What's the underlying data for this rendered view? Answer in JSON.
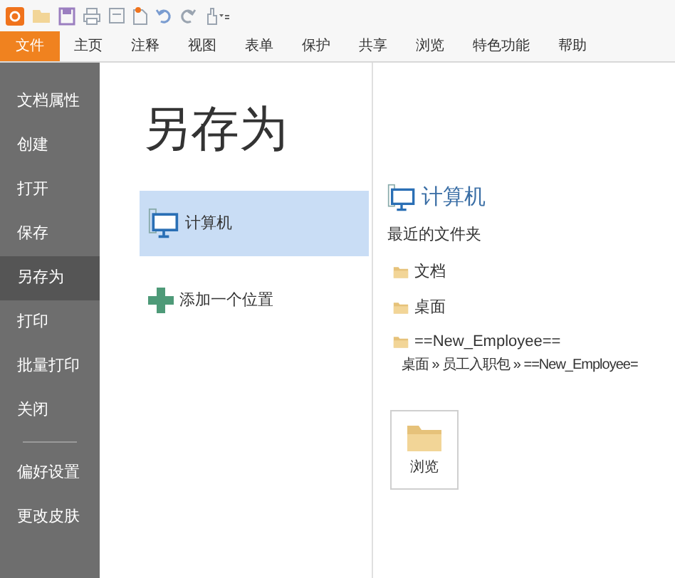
{
  "menu": [
    {
      "label": "文件",
      "selected": true
    },
    {
      "label": "主页",
      "selected": false
    },
    {
      "label": "注释",
      "selected": false
    },
    {
      "label": "视图",
      "selected": false
    },
    {
      "label": "表单",
      "selected": false
    },
    {
      "label": "保护",
      "selected": false
    },
    {
      "label": "共享",
      "selected": false
    },
    {
      "label": "浏览",
      "selected": false
    },
    {
      "label": "特色功能",
      "selected": false
    },
    {
      "label": "帮助",
      "selected": false
    }
  ],
  "sidebar": {
    "items": [
      {
        "label": "文档属性",
        "selected": false
      },
      {
        "label": "创建",
        "selected": false
      },
      {
        "label": "打开",
        "selected": false
      },
      {
        "label": "保存",
        "selected": false
      },
      {
        "label": "另存为",
        "selected": true
      },
      {
        "label": "打印",
        "selected": false
      },
      {
        "label": "批量打印",
        "selected": false
      },
      {
        "label": "关闭",
        "selected": false
      }
    ],
    "items_after_divider": [
      {
        "label": "偏好设置",
        "selected": false
      },
      {
        "label": "更改皮肤",
        "selected": false
      }
    ]
  },
  "title": "另存为",
  "places": [
    {
      "kind": "computer",
      "label": "计算机",
      "selected": true
    },
    {
      "kind": "add",
      "label": "添加一个位置",
      "selected": false
    }
  ],
  "detail": {
    "heading": "计算机",
    "recent_label": "最近的文件夹",
    "folders": [
      {
        "name": "文档"
      },
      {
        "name": "桌面"
      },
      {
        "name": "==New_Employee==",
        "path": "桌面 » 员工入职包 » ==New_Employee="
      }
    ],
    "browse": "浏览"
  }
}
